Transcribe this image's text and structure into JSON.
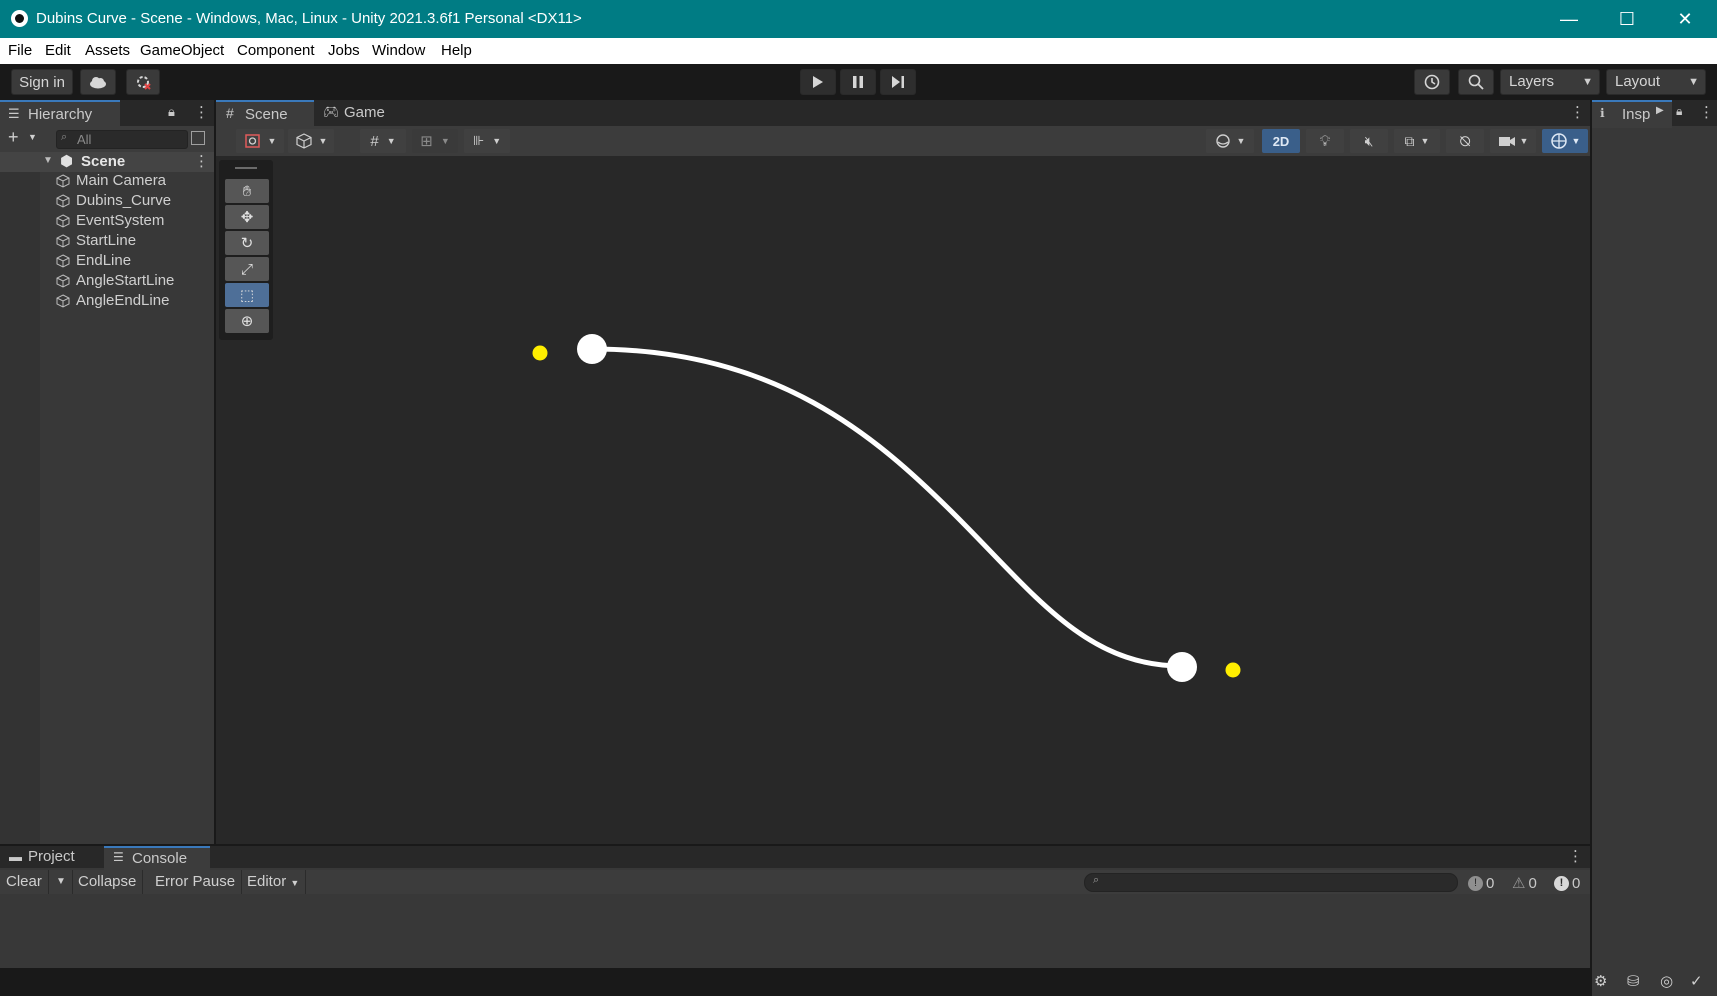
{
  "window": {
    "title": "Dubins Curve - Scene - Windows, Mac, Linux - Unity 2021.3.6f1 Personal <DX11>",
    "minimize": "—",
    "maximize": "☐",
    "close": "✕"
  },
  "menu": [
    "File",
    "Edit",
    "Assets",
    "GameObject",
    "Component",
    "Jobs",
    "Window",
    "Help"
  ],
  "toolbar": {
    "sign_in": "Sign in",
    "layers": "Layers",
    "layout": "Layout"
  },
  "hierarchy": {
    "tab": "Hierarchy",
    "search_placeholder": "All",
    "scene": "Scene",
    "items": [
      "Main Camera",
      "Dubins_Curve",
      "EventSystem",
      "StartLine",
      "EndLine",
      "AngleStartLine",
      "AngleEndLine"
    ]
  },
  "center_tabs": {
    "scene": "Scene",
    "game": "Game"
  },
  "scene_toolbar": {
    "mode_2d": "2D"
  },
  "inspector": {
    "tab": "Insp"
  },
  "bottom_tabs": {
    "project": "Project",
    "console": "Console"
  },
  "console": {
    "clear": "Clear",
    "collapse": "Collapse",
    "error_pause": "Error Pause",
    "editor": "Editor",
    "log_count": "0",
    "warning_count": "0",
    "error_count": "0"
  },
  "colors": {
    "titlebar": "#007c84",
    "scene_bg": "#282828",
    "curve": "#ffffff",
    "marker": "#ffee00",
    "accent": "#3a79bb"
  }
}
